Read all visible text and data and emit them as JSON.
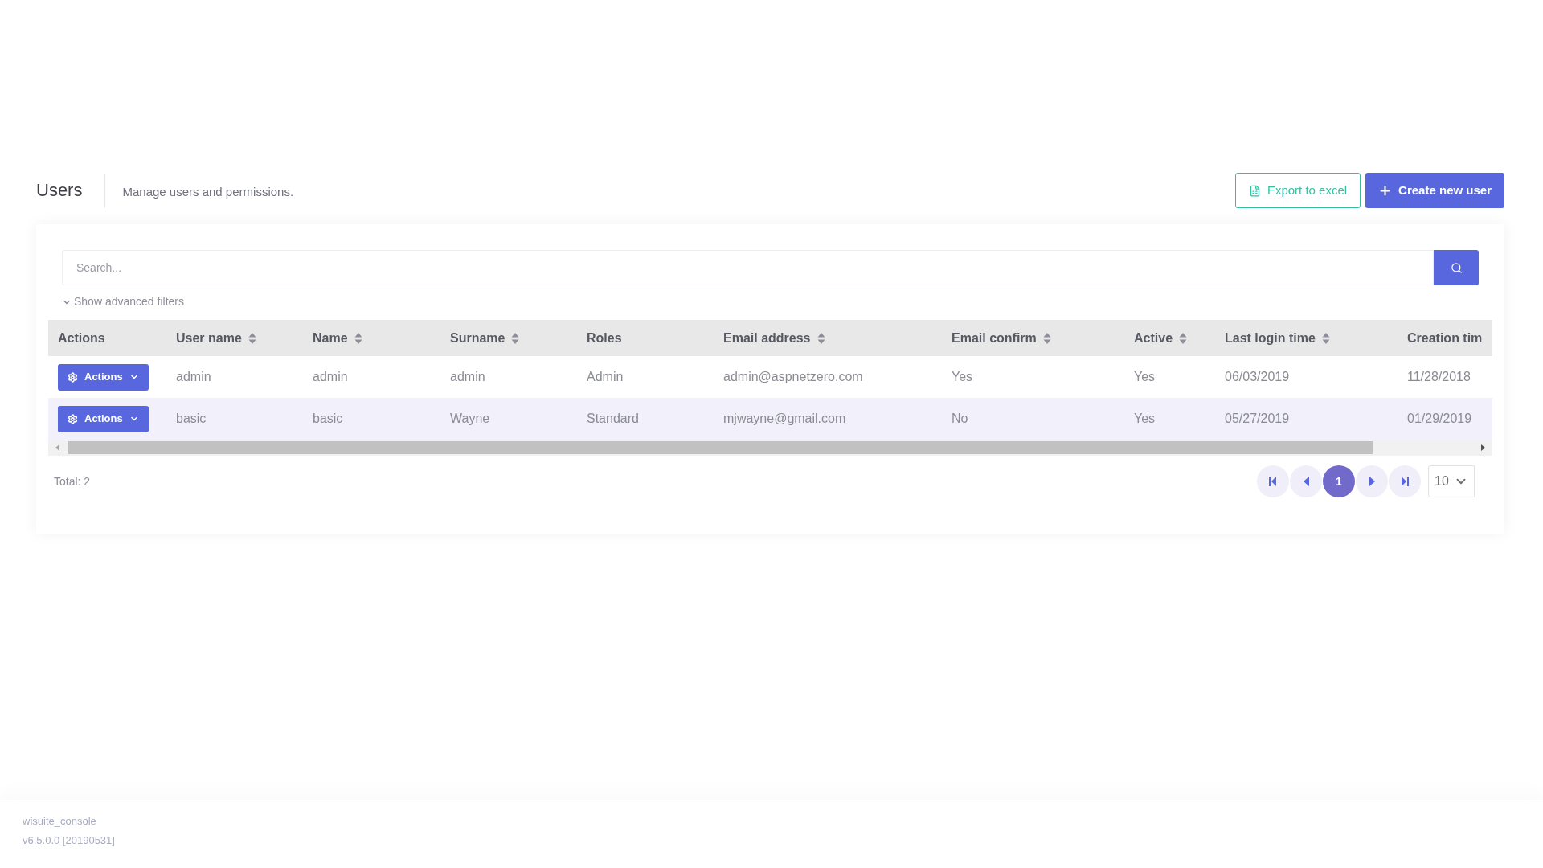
{
  "header": {
    "title": "Users",
    "subtitle": "Manage users and permissions."
  },
  "toolbar": {
    "export_button": "Export to excel",
    "create_button": "Create new user"
  },
  "search": {
    "placeholder": "Search..."
  },
  "advanced_filters": {
    "label": "Show advanced filters",
    "expanded": false
  },
  "table": {
    "columns": [
      {
        "label": "Actions",
        "sortable": false
      },
      {
        "label": "User name",
        "sortable": true
      },
      {
        "label": "Name",
        "sortable": true
      },
      {
        "label": "Surname",
        "sortable": true
      },
      {
        "label": "Roles",
        "sortable": false
      },
      {
        "label": "Email address",
        "sortable": true
      },
      {
        "label": "Email confirm",
        "sortable": true
      },
      {
        "label": "Active",
        "sortable": true
      },
      {
        "label": "Last login time",
        "sortable": true
      },
      {
        "label": "Creation tim",
        "sortable": false
      }
    ],
    "rows": [
      {
        "highlighted": false,
        "cells": [
          "Actions",
          "admin",
          "admin",
          "admin",
          "Admin",
          "admin@aspnetzero.com",
          "Yes",
          "Yes",
          "06/03/2019",
          "11/28/2018"
        ]
      },
      {
        "highlighted": true,
        "cells": [
          "Actions",
          "basic",
          "basic",
          "Wayne",
          "Standard",
          "mjwayne@gmail.com",
          "No",
          "Yes",
          "05/27/2019",
          "01/29/2019"
        ]
      }
    ]
  },
  "total": "Total: 2",
  "pagination": {
    "buttons": [
      {
        "kind": "first",
        "selected": false
      },
      {
        "kind": "prev",
        "selected": false
      },
      {
        "kind": "page",
        "label": "1",
        "selected": true
      },
      {
        "kind": "next",
        "selected": false
      },
      {
        "kind": "last",
        "selected": false
      }
    ],
    "page_size": "10"
  },
  "footer": {
    "app_name": "wisuite_console",
    "version": "v6.5.0.0 [20190531]"
  }
}
